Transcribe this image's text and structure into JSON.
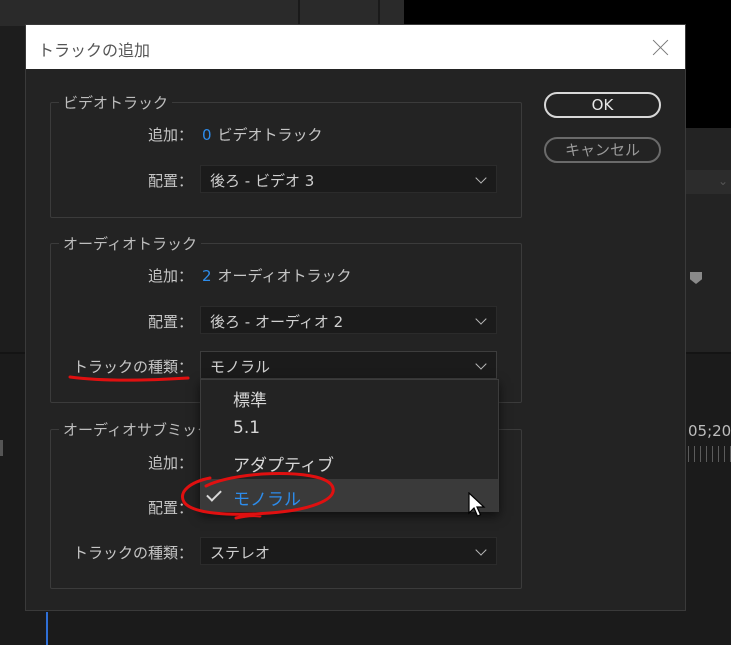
{
  "dialog": {
    "title": "トラックの追加",
    "ok_label": "OK",
    "cancel_label": "キャンセル"
  },
  "video": {
    "legend": "ビデオトラック",
    "add_label": "追加：",
    "add_count": "0",
    "add_unit": "ビデオトラック",
    "placement_label": "配置：",
    "placement_value": "後ろ -  ビデオ 3"
  },
  "audio": {
    "legend": "オーディオトラック",
    "add_label": "追加：",
    "add_count": "2",
    "add_unit": "オーディオトラック",
    "placement_label": "配置：",
    "placement_value": "後ろ -  オーディオ 2",
    "type_label": "トラックの種類：",
    "type_value": "モノラル"
  },
  "submix": {
    "legend": "オーディオサブミックス",
    "add_label": "追加：",
    "placement_label": "配置：",
    "type_label": "トラックの種類：",
    "type_value": "ステレオ"
  },
  "dropdown": {
    "options": [
      "標準",
      "5.1",
      "アダプティブ",
      "モノラル"
    ],
    "selected_index": 3
  },
  "background": {
    "timecode": "05;20"
  },
  "colors": {
    "accent": "#2d8ceb",
    "annotation": "#e01010"
  }
}
